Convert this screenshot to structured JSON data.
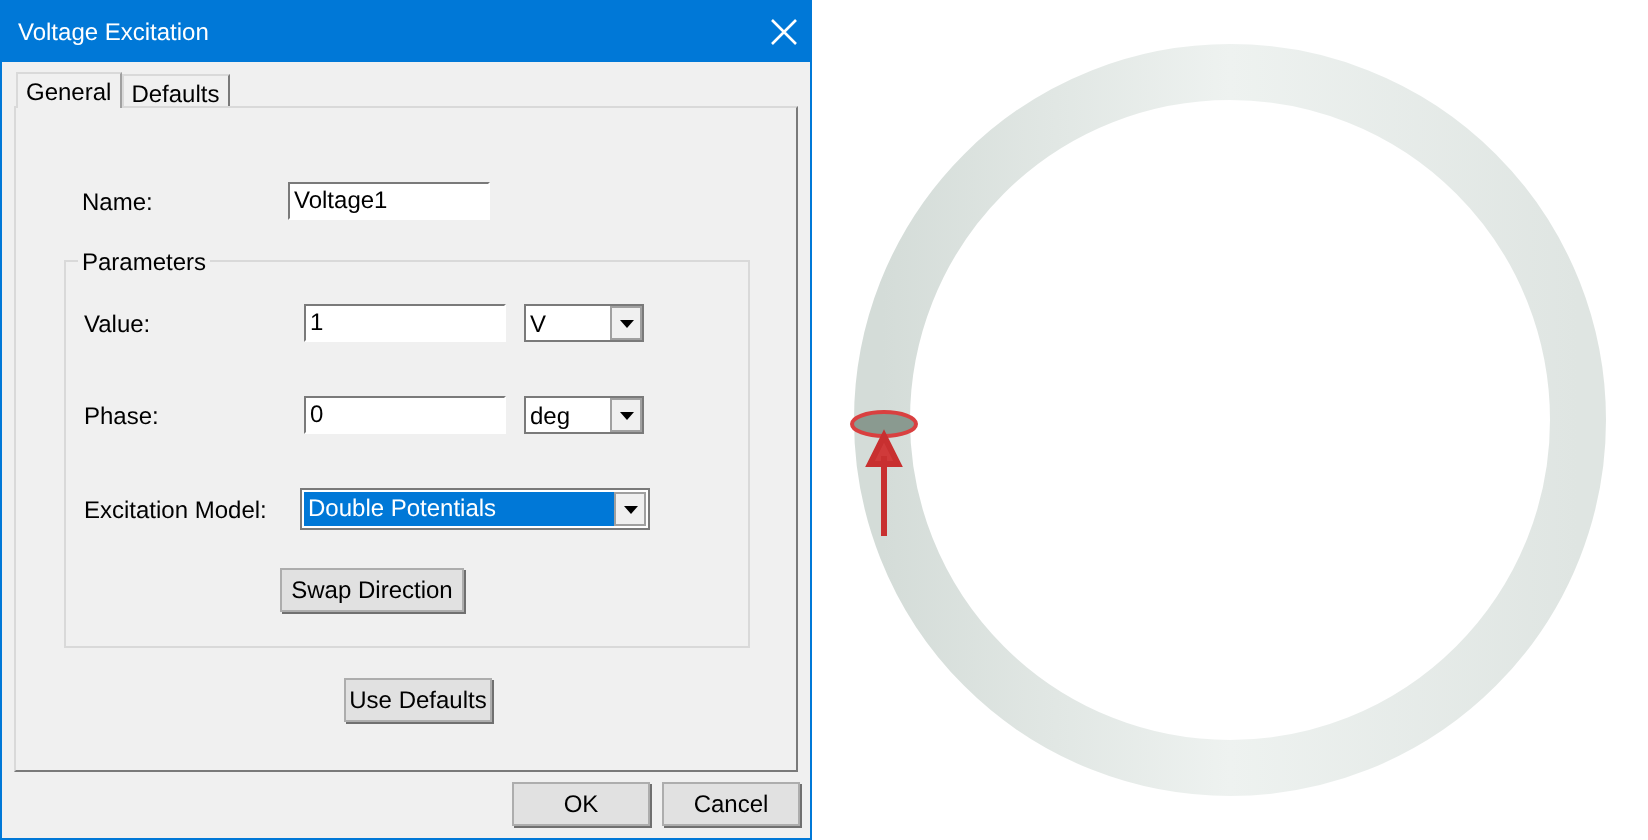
{
  "window": {
    "title": "Voltage Excitation"
  },
  "tabs": [
    {
      "label": "General",
      "selected": true
    },
    {
      "label": "Defaults",
      "selected": false
    }
  ],
  "name_field": {
    "label": "Name:",
    "value": "Voltage1"
  },
  "parameters": {
    "title": "Parameters",
    "rows": [
      {
        "kind": "unit",
        "label": "Value:",
        "value": "1",
        "unit": "V"
      },
      {
        "kind": "unit",
        "label": "Phase:",
        "value": "0",
        "unit": "deg"
      },
      {
        "kind": "model",
        "label": "Excitation Model:",
        "value": "Double Potentials",
        "highlighted": true
      }
    ],
    "swap_button": "Swap Direction"
  },
  "use_defaults_button": "Use Defaults",
  "buttons": [
    "OK",
    "Cancel"
  ]
}
